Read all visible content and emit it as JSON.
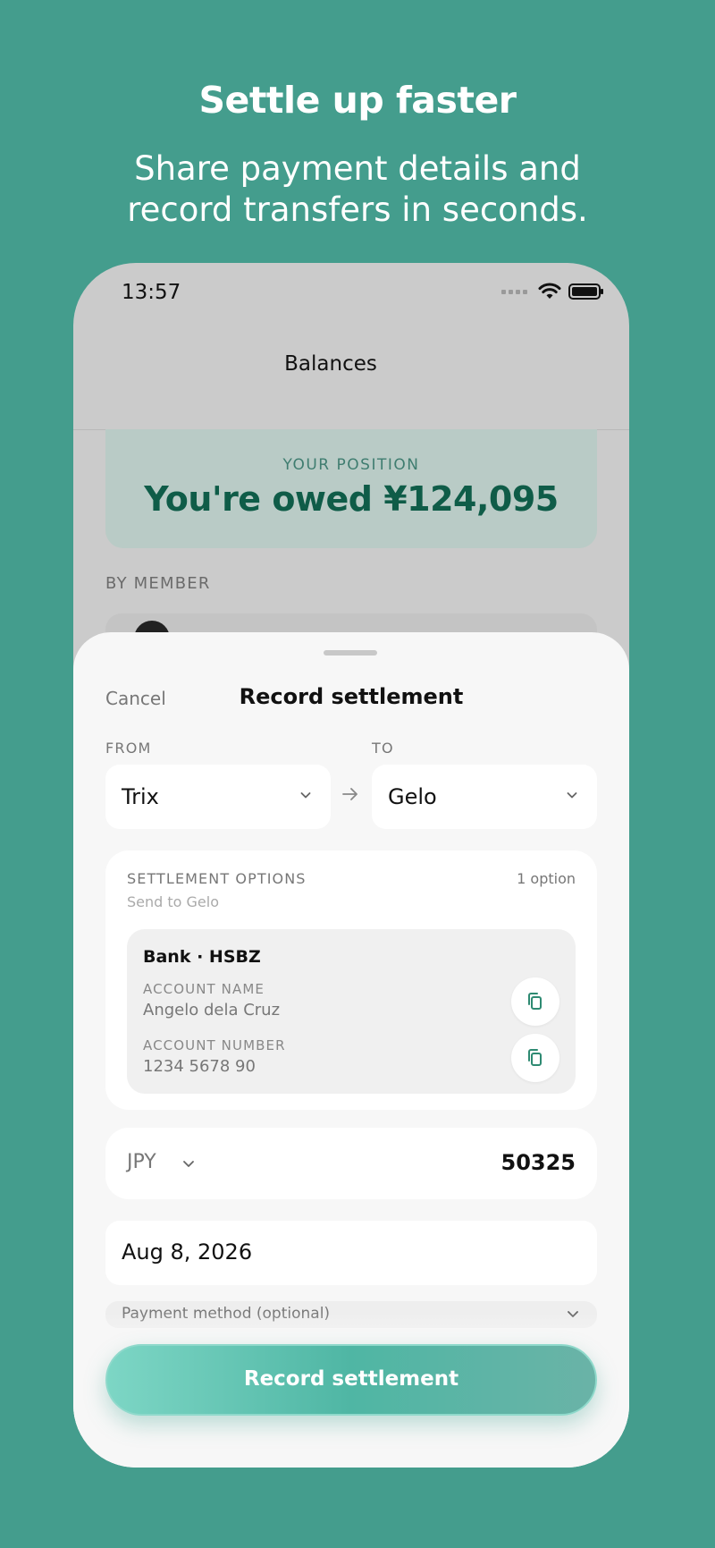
{
  "promo": {
    "title": "Settle up faster",
    "subtitle_line1": "Share payment details and",
    "subtitle_line2": "record transfers in seconds."
  },
  "status_bar": {
    "time": "13:57",
    "icons": [
      "signal-icon",
      "wifi-icon",
      "battery-icon"
    ]
  },
  "balances_screen": {
    "nav_title": "Balances",
    "position_label": "YOUR POSITION",
    "position_value": "You're owed ¥124,095",
    "section_label": "BY MEMBER"
  },
  "sheet": {
    "cancel_label": "Cancel",
    "title": "Record settlement",
    "from_label": "FROM",
    "to_label": "TO",
    "from_value": "Trix",
    "to_value": "Gelo",
    "options": {
      "title": "SETTLEMENT OPTIONS",
      "count": "1 option",
      "subtitle": "Send to Gelo",
      "bank_name": "Bank · HSBZ",
      "account_name_label": "ACCOUNT NAME",
      "account_name": "Angelo dela Cruz",
      "account_number_label": "ACCOUNT NUMBER",
      "account_number": "1234 5678 90"
    },
    "currency": "JPY",
    "amount": "50325",
    "date": "Aug 8, 2026",
    "payment_method_placeholder": "Payment method (optional)",
    "submit_label": "Record settlement"
  },
  "colors": {
    "background": "#449d8d",
    "accent": "#4fb6a4",
    "position_text": "#0f5c48",
    "icon_green": "#2e8a72"
  }
}
